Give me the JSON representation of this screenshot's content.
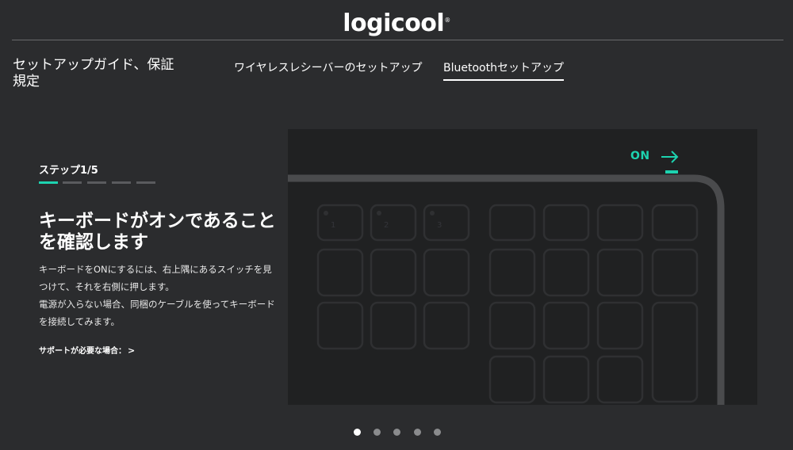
{
  "brand": {
    "logo_text": "logicool",
    "trademark": "®"
  },
  "header": {
    "section_title": "セットアップガイド、保証規定"
  },
  "tabs": [
    {
      "label": "ワイヤレスレシーバーのセットアップ",
      "active": false
    },
    {
      "label": "Bluetoothセットアップ",
      "active": true
    }
  ],
  "step": {
    "label": "ステップ1/5",
    "current": 1,
    "total": 5,
    "heading": "キーボードがオンであることを確認します",
    "paragraph1": "キーボードをONにするには、右上隅にあるスイッチを見つけて、それを右側に押します。",
    "paragraph2": "電源が入らない場合、同梱のケーブルを使ってキーボードを接続してみます。",
    "support_link": "サポートが必要な場合："
  },
  "illustration": {
    "switch_label": "ON",
    "key_labels": [
      "1",
      "2",
      "3"
    ]
  },
  "pager": {
    "count": 5,
    "active_index": 0
  },
  "colors": {
    "background": "#2b2c2e",
    "accent": "#1dd3b0",
    "panel": "#202122",
    "keyboard_frame": "#4a4b4d",
    "key_outline": "#2f3032"
  },
  "icons": {
    "support_chevron": "chevron-right-icon",
    "on_arrow": "arrow-right-icon"
  }
}
